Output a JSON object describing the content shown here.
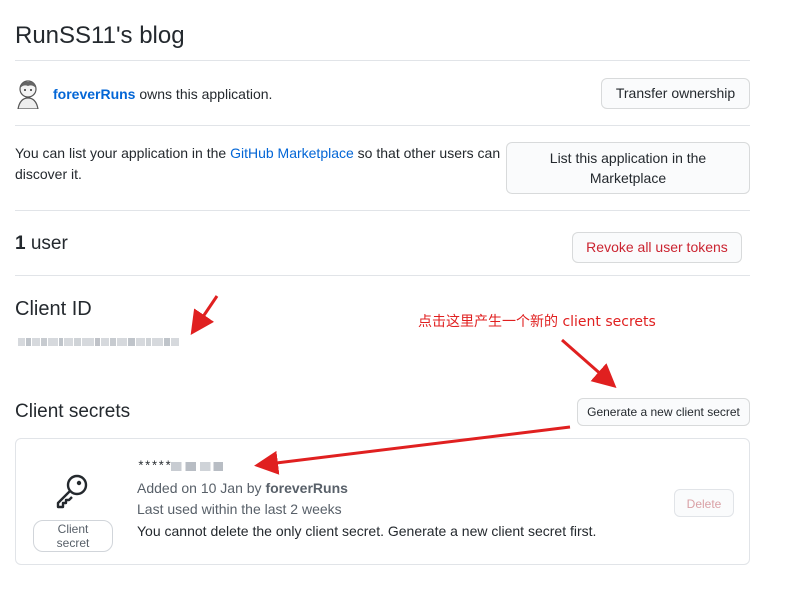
{
  "header": {
    "title": "RunSS11's blog"
  },
  "owner": {
    "username": "foreverRuns",
    "owns_text": "owns this application.",
    "transfer_button": "Transfer ownership"
  },
  "marketplace": {
    "text_before": "You can list your application in the ",
    "link_text": "GitHub Marketplace",
    "text_after": " so that other users can discover it.",
    "button_line1": "List this application in the",
    "button_line2": "Marketplace"
  },
  "users": {
    "count": "1",
    "label": " user",
    "revoke_button": "Revoke all user tokens"
  },
  "client_id": {
    "title": "Client ID"
  },
  "client_secrets": {
    "title": "Client secrets",
    "generate_button": "Generate a new client secret",
    "secret": {
      "badge": "Client secret",
      "masked_prefix": "*****",
      "added_prefix": "Added on 10 Jan by ",
      "added_by": "foreverRuns",
      "last_used": "Last used within the last 2 weeks",
      "warning": "You cannot delete the only client secret. Generate a new client secret first.",
      "delete_button": "Delete"
    }
  },
  "annotation": {
    "text": "点击这里产生一个新的 client secrets",
    "color": "#e02020"
  },
  "colors": {
    "link": "#0366d6",
    "danger": "#cb2431",
    "border": "#e1e4e8"
  }
}
